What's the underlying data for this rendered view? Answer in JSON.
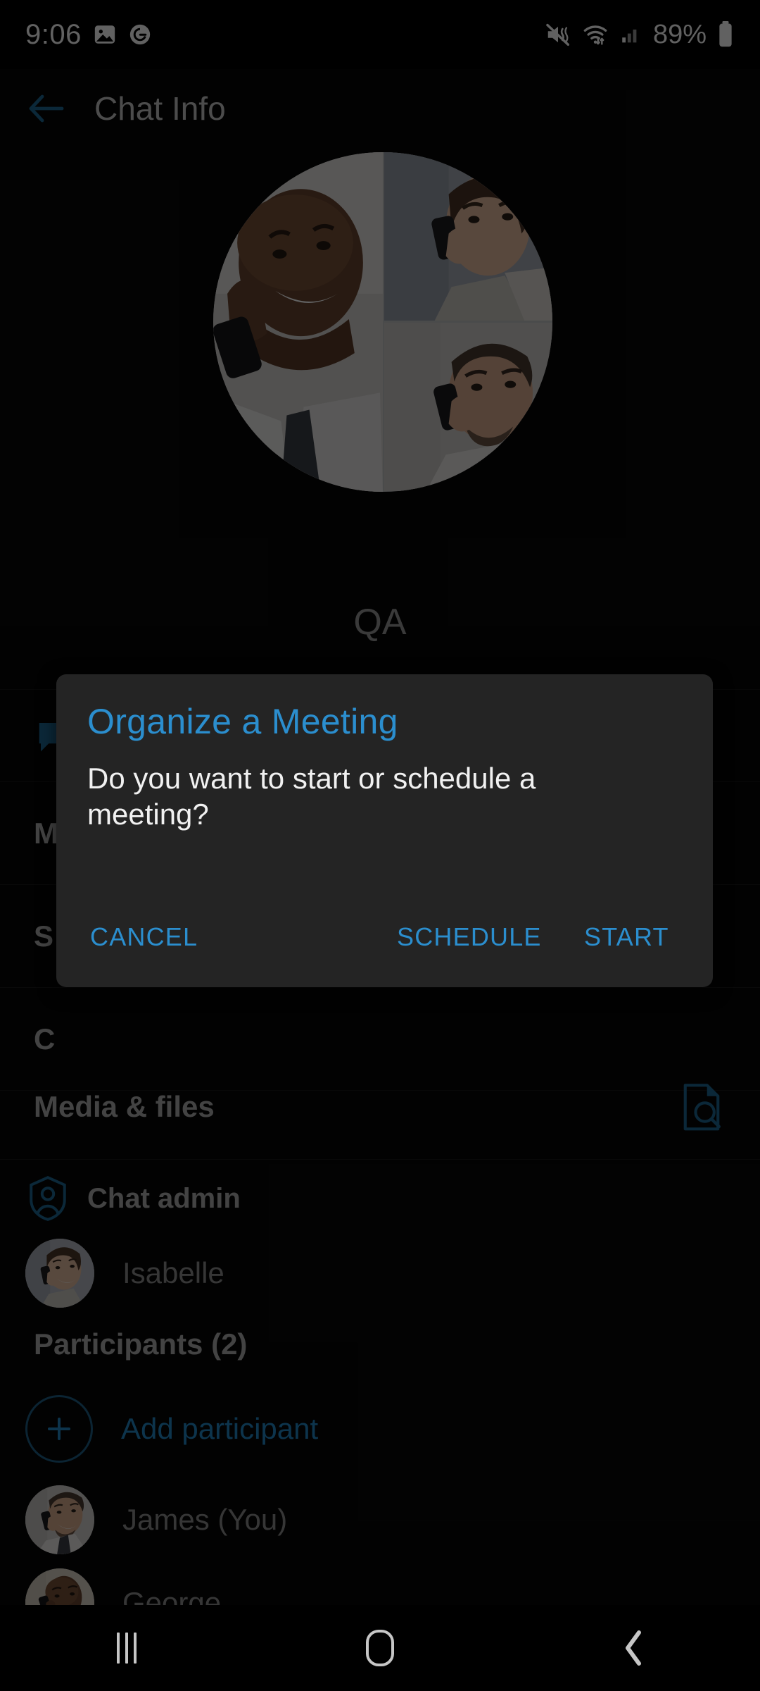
{
  "status_bar": {
    "clock": "9:06",
    "battery_percent": "89%",
    "icons": [
      "image-icon",
      "grammarly-icon",
      "mute-vibrate-icon",
      "wifi-data-icon",
      "cellular-signal-icon",
      "battery-icon"
    ]
  },
  "toolbar": {
    "back_label": "back-arrow",
    "title": "Chat Info"
  },
  "group": {
    "name": "QA",
    "avatar_name": "group-avatar"
  },
  "menu": {
    "items": [
      {
        "label": "",
        "icon": "chat-bubble-icon"
      },
      {
        "label": "M",
        "icon": ""
      },
      {
        "label": "S",
        "icon": ""
      },
      {
        "label": "C",
        "icon": ""
      }
    ]
  },
  "media_files": {
    "label": "Media & files",
    "search_icon": "document-search-icon"
  },
  "chat_admin": {
    "label": "Chat admin",
    "icon": "shield-person-icon",
    "admin_name": "Isabelle"
  },
  "participants": {
    "header": "Participants (2)",
    "add_label": "Add participant",
    "add_icon": "plus-circle-icon",
    "list": [
      {
        "name": "James (You)"
      },
      {
        "name": "George"
      }
    ]
  },
  "dialog": {
    "title": "Organize a Meeting",
    "message": "Do you want to start or schedule a meeting?",
    "cancel_label": "CANCEL",
    "schedule_label": "SCHEDULE",
    "start_label": "START"
  },
  "nav_bar": {
    "recents": "recents-icon",
    "home": "home-icon",
    "back": "back-icon"
  },
  "colors": {
    "accent": "#2b8ece",
    "background": "#070707",
    "dialog_bg": "#242424",
    "text_primary": "#f1f1f1",
    "text_secondary": "#b0b0b0"
  }
}
